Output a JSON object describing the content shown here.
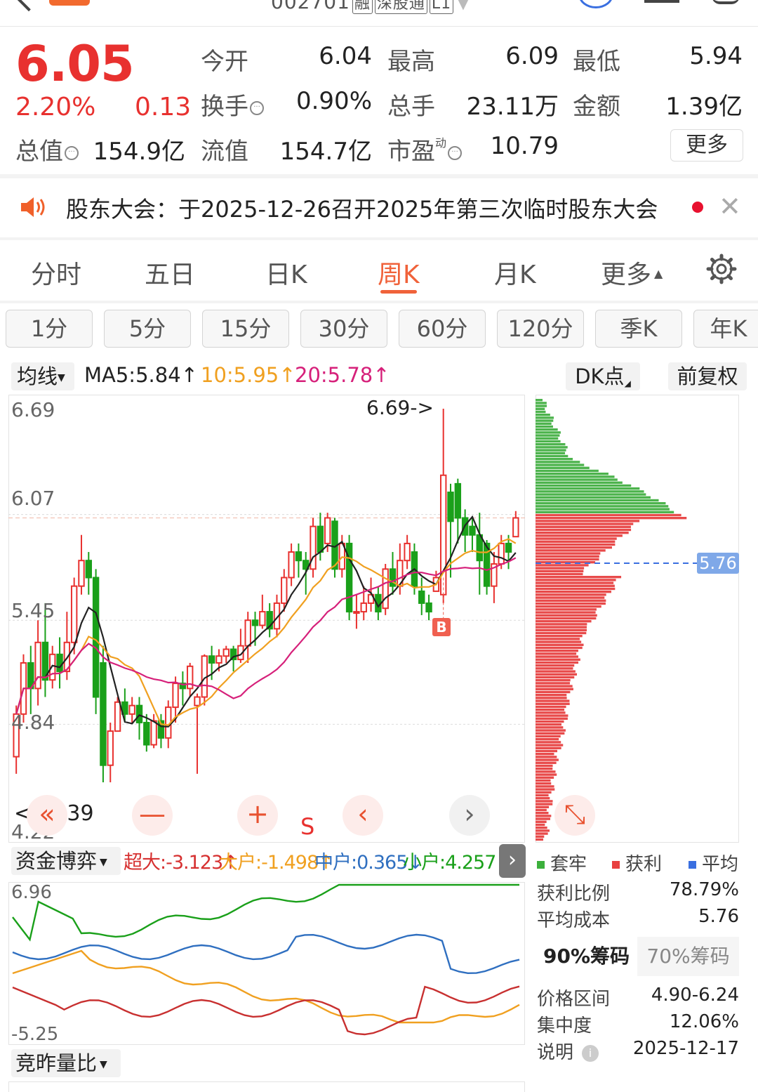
{
  "header": {
    "code": "002701",
    "tags": [
      "融",
      "深股通",
      "L1"
    ]
  },
  "quote": {
    "price": "6.05",
    "change_pct": "2.20%",
    "change_amt": "0.13",
    "open_label": "今开",
    "open": "6.04",
    "high_label": "最高",
    "high": "6.09",
    "low_label": "最低",
    "low": "5.94",
    "turnover_label": "换手",
    "turnover": "0.90%",
    "volume_label": "总手",
    "volume": "23.11万",
    "amount_label": "金额",
    "amount": "1.39亿",
    "mcap_label": "总值",
    "mcap": "154.9亿",
    "float_label": "流值",
    "float_cap": "154.7亿",
    "pe_label": "市盈",
    "pe_sup": "动",
    "pe": "10.79",
    "more_label": "更多"
  },
  "notice": {
    "text": "股东大会：于2025-12-26召开2025年第三次临时股东大会"
  },
  "tabs": [
    "分时",
    "五日",
    "日K",
    "周K",
    "月K",
    "更多"
  ],
  "active_tab": "周K",
  "periods": [
    "1分",
    "5分",
    "15分",
    "30分",
    "60分",
    "120分",
    "季K",
    "年K"
  ],
  "ma_bar": {
    "selector": "均线",
    "ma5": "MA5:5.84↑",
    "ma10": "10:5.95↑",
    "ma20": "20:5.78↑",
    "dk": "DK点",
    "fq": "前复权"
  },
  "kline": {
    "y_labels": [
      "6.69",
      "6.07",
      "5.45",
      "4.84",
      "4.22"
    ],
    "high_marker": "6.69->",
    "low_marker": "<--4.39",
    "b_marker": "B",
    "s_marker": "S",
    "cost_marker": "5.76",
    "colors": {
      "up": "#e8312f",
      "down": "#1aa01a",
      "ma5": "#222222",
      "ma10": "#f0a020",
      "ma20": "#d6207a"
    }
  },
  "fund_flow": {
    "selector": "资金博弈",
    "super_large": "超大:-3.123↑",
    "large": "大户:-1.498↑",
    "medium": "中户:0.365↓",
    "small": "小户:4.257↓",
    "y_top": "6.96",
    "y_bottom": "-5.25"
  },
  "volume_ratio_selector": "竞昨量比",
  "chip": {
    "legend_trapped": "套牢",
    "legend_profit": "获利",
    "legend_avg": "平均",
    "profit_ratio_label": "获利比例",
    "profit_ratio": "78.79%",
    "avg_cost_label": "平均成本",
    "avg_cost": "5.76",
    "tab_90": "90%筹码",
    "tab_70": "70%筹码",
    "range_label": "价格区间",
    "range": "4.90-6.24",
    "concentration_label": "集中度",
    "concentration": "12.06%",
    "note_label": "说明",
    "note_date": "2025-12-17"
  },
  "chart_data": {
    "type": "candlestick",
    "ylim": [
      4.22,
      6.69
    ],
    "candles": [
      [
        4.65,
        4.9,
        4.55,
        4.95
      ],
      [
        4.9,
        5.2,
        4.85,
        5.25
      ],
      [
        5.2,
        5.05,
        4.9,
        5.3
      ],
      [
        5.05,
        5.32,
        4.95,
        5.45
      ],
      [
        5.32,
        5.1,
        5.0,
        5.55
      ],
      [
        5.1,
        5.25,
        5.05,
        5.3
      ],
      [
        5.25,
        5.15,
        5.05,
        5.35
      ],
      [
        5.15,
        5.32,
        5.1,
        5.5
      ],
      [
        5.32,
        5.65,
        5.25,
        5.7
      ],
      [
        5.65,
        5.8,
        5.6,
        5.95
      ],
      [
        5.8,
        5.7,
        5.6,
        5.85
      ],
      [
        5.7,
        5.0,
        4.9,
        5.75
      ],
      [
        5.2,
        4.6,
        4.5,
        5.3
      ],
      [
        4.6,
        4.8,
        4.5,
        4.85
      ],
      [
        4.8,
        4.97,
        4.85,
        5.0
      ],
      [
        4.97,
        4.9,
        4.85,
        5.05
      ],
      [
        4.9,
        4.95,
        4.85,
        5.0
      ],
      [
        4.95,
        4.85,
        4.75,
        5.0
      ],
      [
        4.85,
        4.72,
        4.68,
        4.9
      ],
      [
        4.72,
        4.86,
        4.7,
        4.9
      ],
      [
        4.86,
        4.76,
        4.7,
        4.9
      ],
      [
        4.76,
        4.94,
        4.7,
        4.98
      ],
      [
        4.94,
        5.08,
        4.85,
        5.12
      ],
      [
        5.08,
        5.05,
        4.95,
        5.15
      ],
      [
        5.05,
        5.18,
        5.0,
        5.2
      ],
      [
        4.95,
        5.0,
        4.55,
        5.02
      ],
      [
        5.0,
        5.24,
        4.95,
        5.25
      ],
      [
        5.24,
        5.2,
        5.1,
        5.3
      ],
      [
        5.2,
        5.24,
        5.15,
        5.28
      ],
      [
        5.24,
        5.28,
        5.2,
        5.3
      ],
      [
        5.28,
        5.22,
        5.15,
        5.3
      ],
      [
        5.22,
        5.3,
        5.2,
        5.4
      ],
      [
        5.3,
        5.45,
        5.2,
        5.5
      ],
      [
        5.45,
        5.42,
        5.3,
        5.5
      ],
      [
        5.42,
        5.5,
        5.4,
        5.6
      ],
      [
        5.5,
        5.4,
        5.35,
        5.55
      ],
      [
        5.4,
        5.55,
        5.35,
        5.6
      ],
      [
        5.55,
        5.7,
        5.5,
        5.75
      ],
      [
        5.7,
        5.85,
        5.65,
        5.9
      ],
      [
        5.85,
        5.8,
        5.7,
        5.9
      ],
      [
        5.8,
        5.75,
        5.6,
        5.85
      ],
      [
        5.75,
        6.0,
        5.7,
        6.05
      ],
      [
        6.0,
        5.85,
        5.8,
        6.08
      ],
      [
        5.9,
        6.05,
        5.85,
        6.08
      ],
      [
        6.03,
        5.75,
        5.7,
        6.05
      ],
      [
        5.75,
        5.9,
        5.7,
        5.95
      ],
      [
        5.9,
        5.5,
        5.45,
        5.95
      ],
      [
        5.5,
        5.5,
        5.4,
        5.6
      ],
      [
        5.5,
        5.55,
        5.45,
        5.65
      ],
      [
        5.55,
        5.6,
        5.5,
        5.7
      ],
      [
        5.6,
        5.5,
        5.45,
        5.65
      ],
      [
        5.52,
        5.75,
        5.48,
        5.78
      ],
      [
        5.75,
        5.65,
        5.6,
        5.85
      ],
      [
        5.65,
        5.8,
        5.6,
        5.9
      ],
      [
        5.8,
        5.9,
        5.75,
        5.95
      ],
      [
        5.85,
        5.65,
        5.6,
        5.9
      ],
      [
        5.62,
        5.55,
        5.48,
        5.7
      ],
      [
        5.55,
        5.5,
        5.45,
        5.6
      ],
      [
        5.62,
        5.7,
        5.62,
        5.74
      ],
      [
        5.6,
        6.3,
        5.55,
        6.69
      ],
      [
        6.2,
        6.03,
        5.7,
        6.25
      ],
      [
        6.25,
        6.05,
        5.9,
        6.28
      ],
      [
        6.05,
        5.95,
        5.85,
        6.1
      ],
      [
        6.0,
        5.95,
        5.85,
        6.05
      ],
      [
        5.95,
        5.8,
        5.6,
        6.08
      ],
      [
        5.9,
        5.65,
        5.6,
        5.92
      ],
      [
        5.65,
        5.78,
        5.55,
        5.85
      ],
      [
        5.78,
        5.9,
        5.75,
        5.95
      ],
      [
        5.9,
        5.85,
        5.75,
        5.95
      ],
      [
        5.94,
        6.05,
        5.94,
        6.09
      ]
    ]
  }
}
